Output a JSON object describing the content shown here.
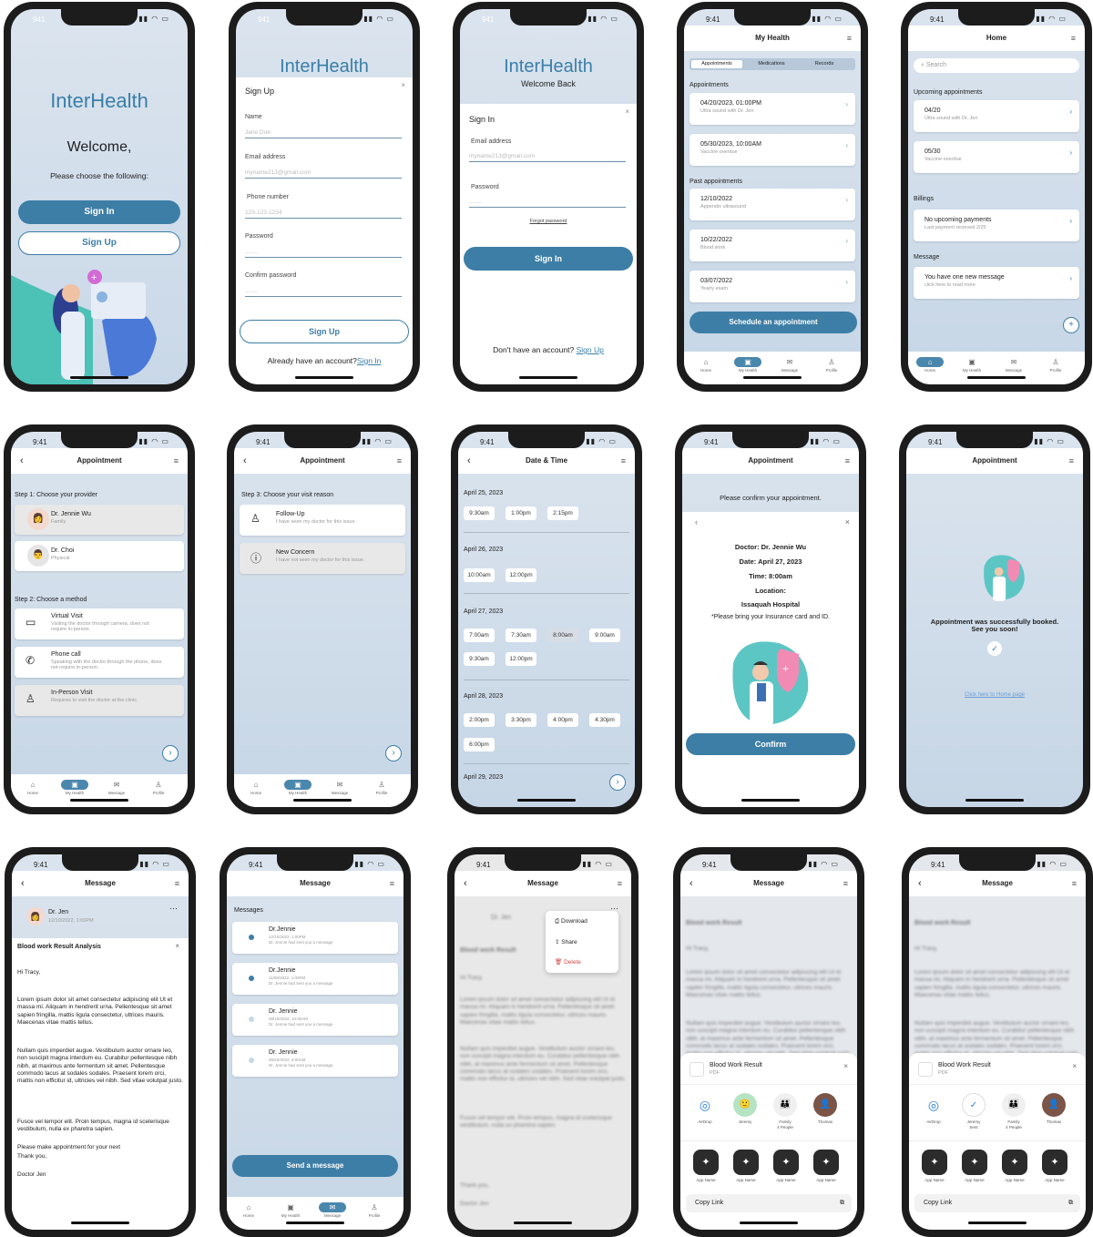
{
  "status_time": "9:41",
  "status_time_alt": "941",
  "brand": "InterHealth",
  "welcome": {
    "title": "Welcome,",
    "subtitle": "Please choose the following:",
    "signin": "Sign In",
    "signup": "Sign Up"
  },
  "signup": {
    "title": "Sign Up",
    "name_label": "Name",
    "name_ph": "Jane Doe",
    "email_label": "Email address",
    "email_ph": "myname213@gmail.com",
    "phone_label": "Phone number",
    "phone_ph": "123-123-1234",
    "pw_label": "Password",
    "pw_ph": "........",
    "cpw_label": "Confirm password",
    "cpw_ph": "........",
    "button": "Sign Up",
    "already": "Already have an account?",
    "signin_link": "Sign In"
  },
  "signin": {
    "welcome_back": "Welcome Back",
    "title": "Sign In",
    "email_label": "Email address",
    "email_ph": "myname213@gmail.com",
    "pw_label": "Password",
    "pw_ph": "........",
    "forgot": "Forgot password",
    "button": "Sign In",
    "no_account": "Don't have an account?",
    "signup_link": "Sign Up"
  },
  "myhealth": {
    "title": "My Health",
    "tabs": [
      "Appointments",
      "Medications",
      "Records"
    ],
    "appts_label": "Appointments",
    "appts": [
      {
        "t": "04/20/2023, 01:00PM",
        "s": "Ultra sound with Dr. Jen"
      },
      {
        "t": "05/30/2023, 10:00AM",
        "s": "Vaccine overdue"
      }
    ],
    "past_label": "Past appointments",
    "past": [
      {
        "t": "12/10/2022",
        "s": "Appendix ultrasound"
      },
      {
        "t": "10/22/2022",
        "s": "Blood work"
      },
      {
        "t": "03/07/2022",
        "s": "Yearly exam"
      }
    ],
    "schedule": "Schedule an appointment"
  },
  "home": {
    "title": "Home",
    "search": "Search",
    "upcoming": "Upcoming appointments",
    "appts": [
      {
        "t": "04/20",
        "s": "Ultra sound with Dr. Jen"
      },
      {
        "t": "05/30",
        "s": "Vaccine overdue"
      }
    ],
    "billings": "Billings",
    "bill": {
      "t": "No upcoming payments",
      "s": "Last payment recieved 2/25"
    },
    "message": "Message",
    "msg": {
      "t": "You have one new message",
      "s": "click here to read more"
    }
  },
  "tabs": {
    "home": "Home",
    "health": "My Health",
    "message": "Message",
    "profile": "Profile"
  },
  "appt1": {
    "title": "Appointment",
    "step1": "Step 1: Choose your provider",
    "providers": [
      {
        "name": "Dr. Jennie Wu",
        "spec": "Family"
      },
      {
        "name": "Dr. Choi",
        "spec": "Physical"
      }
    ],
    "step2": "Step 2: Choose a method",
    "methods": [
      {
        "t": "Virtual Visit",
        "s": "Visiting the doctor through camera, does not require in-person."
      },
      {
        "t": "Phone call",
        "s": "Speaking with the doctor through the phone, does not require in-person."
      },
      {
        "t": "In-Person Visit",
        "s": "Requires to visit the doctor at the clinic."
      }
    ]
  },
  "appt2": {
    "title": "Appointment",
    "step3": "Step 3: Choose your visit reason",
    "reasons": [
      {
        "t": "Follow-Up",
        "s": "I have seen my doctor for this issue."
      },
      {
        "t": "New Concern",
        "s": "I have not seen my doctor for this issue."
      }
    ]
  },
  "datetime": {
    "title": "Date & Time",
    "days": [
      {
        "d": "April 25, 2023",
        "slots": [
          "9:30am",
          "1:00pm",
          "2:15pm"
        ]
      },
      {
        "d": "April 26, 2023",
        "slots": [
          "10:00am",
          "12:00pm"
        ]
      },
      {
        "d": "April 27, 2023",
        "slots": [
          "7:00am",
          "7:30am",
          "8:00am",
          "9:00am",
          "9:30am",
          "12:00pm"
        ]
      },
      {
        "d": "April 28, 2023",
        "slots": [
          "2:00pm",
          "3:30pm",
          "4:00pm",
          "4:30pm",
          "6:00pm"
        ]
      },
      {
        "d": "April 29, 2023",
        "slots": []
      }
    ]
  },
  "confirm": {
    "title": "Appointment",
    "prompt": "Please confirm your appointment.",
    "doctor": "Doctor: Dr. Jennie Wu",
    "date": "Date: April 27, 2023",
    "time": "Time: 8:00am",
    "location_label": "Location:",
    "location": "Issaquah Hospital",
    "note": "*Please bring your Insurance card and ID.",
    "button": "Confirm"
  },
  "booked": {
    "title": "Appointment",
    "msg1": "Appointment was successfully booked.",
    "msg2": "See you soon!",
    "link": "Click here to Home page"
  },
  "message1": {
    "title": "Message",
    "from": "Dr. Jen",
    "date": "12/10/2022, 1:00PM",
    "subject": "Blood work Result Analysis",
    "greeting": "Hi Tracy,",
    "p1": "Lorem ipsum dolor sit amet consectetur adipiscing elit Ut et massa mi. Aliquam in hendrerit urna. Pellentesque sit amet sapien fringilla, mattis ligula consectetur, ultrices mauris. Maecenas vitae mattis tellus.",
    "p2": "Nullam quis imperdiet augue. Vestibulum auctor ornare leo, non suscipit magna interdum eu. Curabitur pellentesque nibh nibh, at maximus ante fermentum sit amet. Pellentesque commodo lacus at sodales sodales. Praesent lorem orci, mattis non efficitur id, ultricies vel nibh. Sed vitae volutpat justo.",
    "p3": "Fusce vel tempor elit. Proin tempus, magna id scelerisque vestibulum, nulla ex pharetra sapien.",
    "p4": "Please make appointment for your next",
    "p5": "Thank you,",
    "sign": "Doctor Jen"
  },
  "messages": {
    "title": "Message",
    "label": "Messages",
    "items": [
      {
        "n": "Dr.Jennie",
        "d": "12/10/2022, 1:00PM",
        "s": "Dr. Jennie had sent you a message"
      },
      {
        "n": "Dr.Jennie",
        "d": "11/08/2022, 1:00PM",
        "s": "Dr. Jennie had sent you a message"
      },
      {
        "n": "Dr. Jennie",
        "d": "09/10/2022, 10:00AM",
        "s": "Dr. Jennie had sent you a message"
      },
      {
        "n": "Dr. Jennie",
        "d": "05/20/2022, 9:00AM",
        "s": "Dr. Jennie had sent you a message"
      }
    ],
    "send": "Send a message"
  },
  "msgmenu": {
    "title": "Message",
    "from": "Dr. Jen",
    "subject": "Blood work Result",
    "greeting": "Hi Tracy,",
    "menu": [
      "Download",
      "Share",
      "Delete"
    ],
    "thanks": "Thank you,",
    "sign": "Doctor Jen"
  },
  "share": {
    "title": "Message",
    "subject": "Blood work Result",
    "greeting": "Hi Tracy,",
    "file": "Blood Work Result",
    "ext": "PDF",
    "people": [
      {
        "n": "AirDrop",
        "s": ""
      },
      {
        "n": "Jeremy",
        "s": ""
      },
      {
        "n": "Family",
        "s": "4 People"
      },
      {
        "n": "Thomas",
        "s": ""
      }
    ],
    "people_sent": [
      {
        "n": "AirDrop",
        "s": ""
      },
      {
        "n": "Jeremy",
        "s": "Sent"
      },
      {
        "n": "Family",
        "s": "4 People"
      },
      {
        "n": "Thomas",
        "s": ""
      }
    ],
    "apps": [
      "App Name",
      "App Name",
      "App Name",
      "App Name"
    ],
    "copy": "Copy Link"
  }
}
